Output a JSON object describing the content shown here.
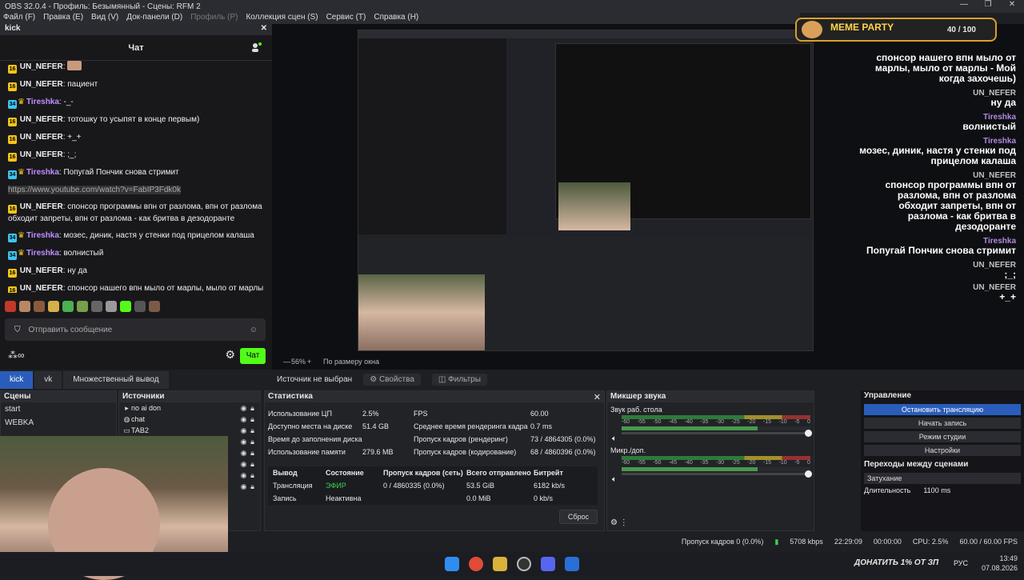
{
  "window": {
    "title": "OBS 32.0.4 - Профиль: Безымянный - Сцены: RFM 2",
    "controls": [
      "—",
      "❐",
      "✕"
    ]
  },
  "menu": [
    "Файл (F)",
    "Правка (E)",
    "Вид (V)",
    "Док-панели (D)",
    "Профиль (P)",
    "Коллекция сцен (S)",
    "Сервис (T)",
    "Справка (H)"
  ],
  "chat_dock": {
    "dock_title": "kick",
    "header": "Чат",
    "messages": [
      {
        "badge": "16",
        "name": "UN_NEFER",
        "text": "",
        "color": "#ffffff"
      },
      {
        "badge": "16",
        "name": "UN_NEFER",
        "text": "пациент",
        "color": "#ffffff"
      },
      {
        "badge": "34",
        "name": "Tireshka",
        "text": "-_-",
        "color": "#c08fff"
      },
      {
        "badge": "16",
        "name": "UN_NEFER",
        "text": "тотошку то усыпят в конце первым)",
        "color": "#ffffff"
      },
      {
        "badge": "16",
        "name": "UN_NEFER",
        "text": "+_+",
        "color": "#ffffff"
      },
      {
        "badge": "16",
        "name": "UN_NEFER",
        "text": ";_;",
        "color": "#ffffff"
      },
      {
        "badge": "34",
        "name": "Tireshka",
        "text": "Попугай Пончик снова стримит",
        "color": "#c08fff"
      },
      {
        "badge": "",
        "name": "",
        "text": "https://www.youtube.com/watch?v=FabIP3Fdk0k",
        "color": "#aaaaaa"
      },
      {
        "badge": "16",
        "name": "UN_NEFER",
        "text": "спонсор программы впн от разлома, впн от разлома обходит запреты, впн от разлома - как бритва в дезодоранте",
        "color": "#ffffff"
      },
      {
        "badge": "34",
        "name": "Tireshka",
        "text": "мозес, диник, настя у стенки под прицелом калаша",
        "color": "#c08fff"
      },
      {
        "badge": "34",
        "name": "Tireshka",
        "text": "волнистый",
        "color": "#c08fff"
      },
      {
        "badge": "16",
        "name": "UN_NEFER",
        "text": "ну да",
        "color": "#ffffff"
      },
      {
        "badge": "16",
        "name": "UN_NEFER",
        "text": "спонсор нашего впн мыло от марлы, мыло от марлы - Мой когда захочешь)",
        "color": "#ffffff"
      }
    ],
    "input_placeholder": "Отправить сообщение",
    "send_label": "Чат"
  },
  "preview": {
    "zoom": "56%",
    "fit": "По размеру окна",
    "meme_title": "MEME PARTY",
    "meme_progress": "40 / 100",
    "donate_text": "ДОНАТИТЬ 1% ОТ ЗП",
    "right_chat": [
      {
        "name": "",
        "text": "спонсор нашего впн мыло от марлы, мыло от марлы - Мой когда захочешь)"
      },
      {
        "name": "UN_NEFER",
        "text": "ну да"
      },
      {
        "name": "Tireshka",
        "text": "волнистый"
      },
      {
        "name": "Tireshka",
        "text": "мозес, диник, настя у стенки под прицелом калаша"
      },
      {
        "name": "UN_NEFER",
        "text": "спонсор программы впн от разлома, впн от разлома обходит запреты, впн от разлома - как бритва в дезодоранте"
      },
      {
        "name": "Tireshka",
        "text": "Попугай Пончик снова стримит"
      },
      {
        "name": "UN_NEFER",
        "text": ";_;"
      },
      {
        "name": "UN_NEFER",
        "text": "+_+"
      }
    ]
  },
  "tabs": [
    "kick",
    "vk",
    "Множественный вывод"
  ],
  "source_bar": {
    "label": "Источник не выбран",
    "properties": "Свойства",
    "filters": "Фильтры"
  },
  "scenes": {
    "title": "Сцены",
    "items": [
      "start",
      "WEBKA"
    ]
  },
  "sources": {
    "title": "Источники",
    "items": [
      "no ai don",
      "chat",
      "TAB2"
    ]
  },
  "stats": {
    "title": "Статистика",
    "rows": [
      {
        "k": "Использование ЦП",
        "v": "2.5%",
        "k2": "FPS",
        "v2": "60.00"
      },
      {
        "k": "Доступно места на диске",
        "v": "51.4 GB",
        "k2": "Среднее время рендеринга кадра",
        "v2": "0.7 ms"
      },
      {
        "k": "Время до заполнения диска",
        "v": "",
        "k2": "Пропуск кадров (рендеринг)",
        "v2": "73 / 4864305 (0.0%)"
      },
      {
        "k": "Использование памяти",
        "v": "279.6 MB",
        "k2": "Пропуск кадров (кодирование)",
        "v2": "68 / 4860396 (0.0%)"
      }
    ],
    "out_headers": [
      "Вывод",
      "Состояние",
      "Пропуск кадров (сеть)",
      "Всего отправлено",
      "Битрейт"
    ],
    "out_rows": [
      [
        "Трансляция",
        "ЭФИР",
        "0 / 4860335 (0.0%)",
        "53.5 GiB",
        "6182 kb/s"
      ],
      [
        "Запись",
        "Неактивна",
        "",
        "0.0 MiB",
        "0 kb/s"
      ]
    ],
    "reset": "Сброс"
  },
  "mixer": {
    "title": "Микшер звука",
    "channels": [
      {
        "name": "Звук раб. стола"
      },
      {
        "name": "Микр./доп."
      }
    ],
    "scale": [
      "-60",
      "-55",
      "-50",
      "-45",
      "-40",
      "-35",
      "-30",
      "-25",
      "-20",
      "-15",
      "-10",
      "-5",
      "0"
    ]
  },
  "control": {
    "title": "Управление",
    "buttons": [
      "Остановить трансляцию",
      "Начать запись",
      "Режим студии",
      "Настройки"
    ],
    "transitions_title": "Переходы между сценами",
    "transition": "Затухание",
    "duration_label": "Длительность",
    "duration": "1100 ms"
  },
  "statusbar": {
    "dropped": "Пропуск кадров 0 (0.0%)",
    "bitrate": "5708 kbps",
    "rec_time": "22:29:09",
    "timer": "00:00:00",
    "cpu": "CPU: 2.5%",
    "fps": "60.00 / 60.00 FPS"
  },
  "taskbar": {
    "time": "13:49",
    "date": "07.08.2026",
    "lang": "РУС"
  }
}
